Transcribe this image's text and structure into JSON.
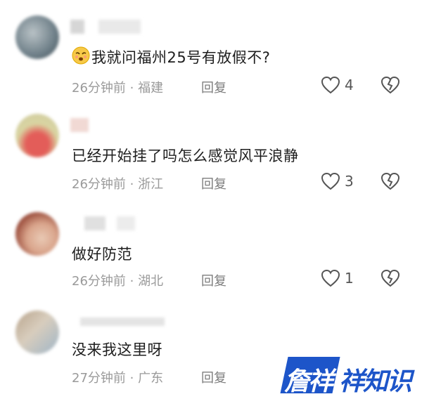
{
  "comments": [
    {
      "text": "我就问福州25号有放假不?",
      "time": "26分钟前",
      "location": "福建",
      "reply_label": "回复",
      "likes": "4",
      "has_emoji": true,
      "avatar_colors": [
        "#6e7f88",
        "#b9c2c6"
      ]
    },
    {
      "text": "已经开始挂了吗怎么感觉风平浪静",
      "time": "26分钟前",
      "location": "浙江",
      "reply_label": "回复",
      "likes": "3",
      "avatar_colors": [
        "#d9d5a2",
        "#e35d59"
      ]
    },
    {
      "text": "做好防范",
      "time": "26分钟前",
      "location": "湖北",
      "reply_label": "回复",
      "likes": "1",
      "avatar_colors": [
        "#8e3b2c",
        "#e9c9b4"
      ]
    },
    {
      "text": "没来我这里呀",
      "time": "27分钟前",
      "location": "广东",
      "reply_label": "回复",
      "likes": "",
      "avatar_colors": [
        "#b8a48c",
        "#9fb5c7"
      ]
    }
  ],
  "meta_separator": " · ",
  "watermark": {
    "part1": "詹祥",
    "part2": "祥知识",
    "color": "#1d55c9"
  }
}
